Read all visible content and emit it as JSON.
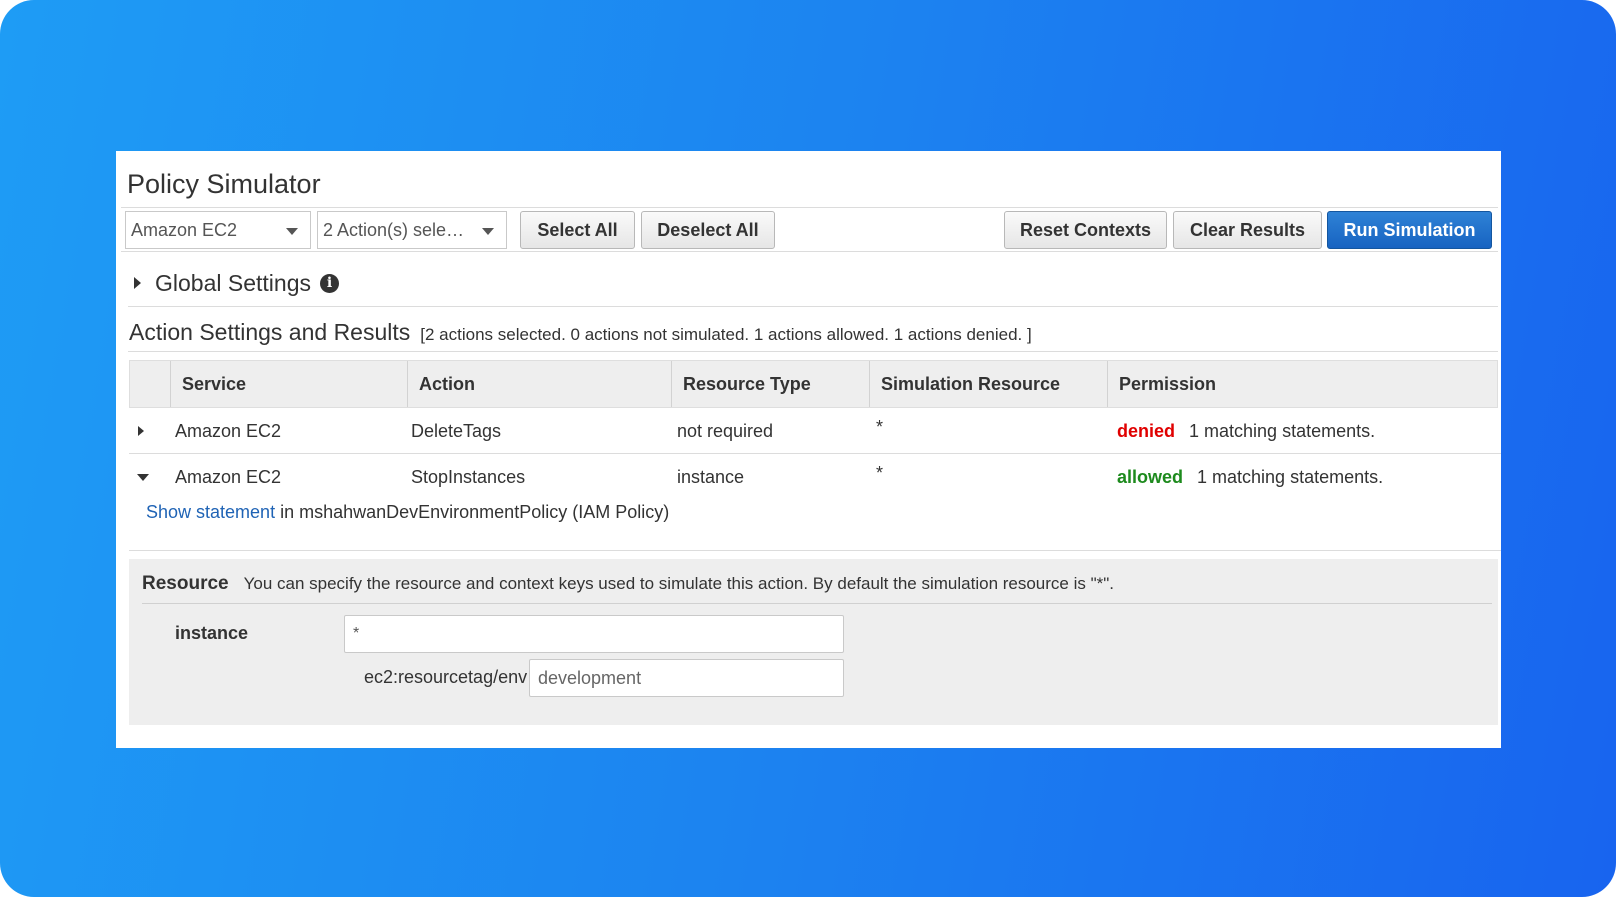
{
  "title": "Policy Simulator",
  "toolbar": {
    "service_select": "Amazon EC2",
    "actions_select": "2 Action(s) sele…",
    "select_all": "Select All",
    "deselect_all": "Deselect All",
    "reset_contexts": "Reset Contexts",
    "clear_results": "Clear Results",
    "run_simulation": "Run Simulation"
  },
  "global_settings": {
    "label": "Global Settings",
    "info_glyph": "i"
  },
  "action_settings": {
    "title": "Action Settings and Results",
    "summary": "[2 actions selected. 0 actions not simulated. 1 actions allowed. 1 actions denied. ]"
  },
  "table": {
    "headers": [
      "Service",
      "Action",
      "Resource Type",
      "Simulation Resource",
      "Permission"
    ],
    "rows": [
      {
        "service": "Amazon EC2",
        "action": "DeleteTags",
        "resource_type": "not required",
        "simulation_resource": "*",
        "permission": "denied",
        "matching": "1 matching statements.",
        "expanded": false
      },
      {
        "service": "Amazon EC2",
        "action": "StopInstances",
        "resource_type": "instance",
        "simulation_resource": "*",
        "permission": "allowed",
        "matching": "1 matching statements.",
        "expanded": true
      }
    ]
  },
  "statement": {
    "link": "Show statement",
    "text": " in mshahwanDevEnvironmentPolicy (IAM Policy)"
  },
  "resource": {
    "title": "Resource",
    "description": "You can specify the resource and context keys used to simulate this action. By default the simulation resource is \"*\".",
    "label": "instance",
    "value": "*",
    "context_key": "ec2:resourcetag/env",
    "context_value": "development"
  },
  "colors": {
    "denied": "#e00000",
    "allowed": "#1d8a1d",
    "primary_button": "#1f6fcf",
    "link": "#1f63b5",
    "background_gradient_start": "#1e9cf5",
    "background_gradient_end": "#1864ef"
  }
}
